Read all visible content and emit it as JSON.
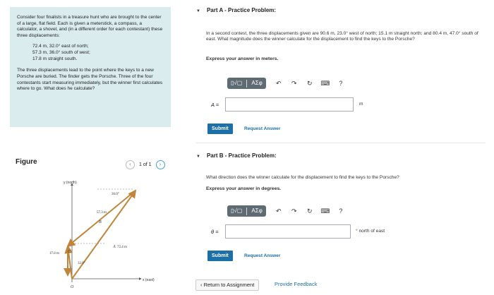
{
  "problem": {
    "intro": "Consider four finalists in a treasure hunt who are brought to the center of a large, flat field. Each is given a meterstick, a compass, a calculator, a shovel, and (in a different order for each contestant) these three displacements:",
    "displacements": [
      "72.4 m, 32.0° east of north;",
      "57.3 m, 36.0° south of west;",
      "17.8 m straight south."
    ],
    "outro": "The three displacements lead to the point where the keys to a new Porsche are buried. The finder gets the Porsche. Three of the four contestants start measuring immediately, but the winner first calculates where to go. What does he calculate?"
  },
  "figure": {
    "title": "Figure",
    "pager": {
      "text": "1 of 1",
      "prev": "‹",
      "next": "›"
    },
    "labels": {
      "north": "y (north)",
      "east": "x (east)",
      "origin": "O",
      "a": "A",
      "b": "B",
      "c": "C",
      "b_len": "57.3 m",
      "a_len": "72.4 m",
      "c_len": "17.8 m",
      "angle_b": "36.0°",
      "angle_a": "32.0°"
    }
  },
  "partA": {
    "caret": "▼",
    "title": "Part A - Practice Problem:",
    "question": "In a second contest, the three displacements given are 90.6 m, 23.0° west of north; 15.1 m straight north; and 80.4 m, 47.0° south of east. What magnitude does the winner calculate for the displacement to find the keys to the Porsche?",
    "instruction": "Express your answer in meters.",
    "var": "A =",
    "unit": "m",
    "submit": "Submit",
    "request": "Request Answer"
  },
  "partB": {
    "caret": "▼",
    "title": "Part B - Practice Problem:",
    "question": "What direction does the winner calculate for the displacement to find the keys to the Porsche?",
    "instruction": "Express your answer in degrees.",
    "var": "θ =",
    "unit": "° north of east",
    "submit": "Submit",
    "request": "Request Answer"
  },
  "toolbar": {
    "templates": "▯√▢",
    "symbols": "ΑΣφ",
    "undo": "↶",
    "redo": "↷",
    "reset": "↻",
    "keyboard": "⌨",
    "help": "?"
  },
  "footer": {
    "return": "‹ Return to Assignment",
    "feedback": "Provide Feedback"
  }
}
